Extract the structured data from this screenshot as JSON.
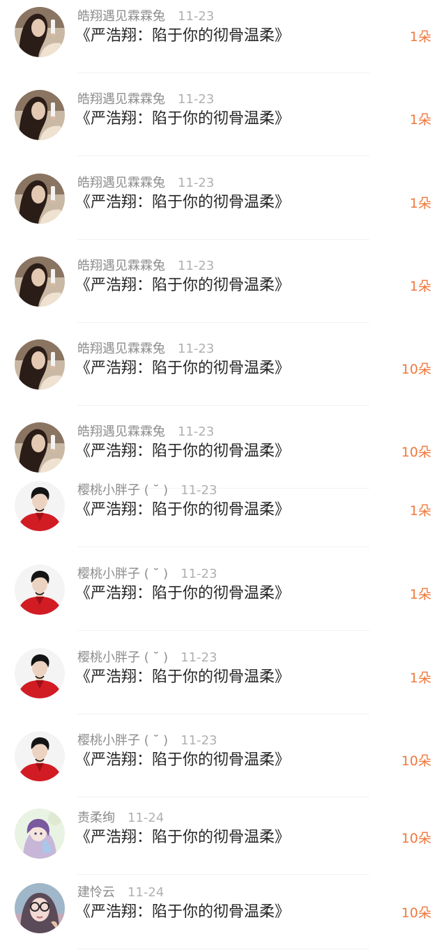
{
  "gifts": [
    {
      "user": "皓翔遇见霖霖兔",
      "date": "11-23",
      "book": "《严浩翔：陷于你的彻骨温柔》",
      "count": "1朵",
      "avatar": "avatar-dark-hair-woman-icon"
    },
    {
      "user": "皓翔遇见霖霖兔",
      "date": "11-23",
      "book": "《严浩翔：陷于你的彻骨温柔》",
      "count": "1朵",
      "avatar": "avatar-dark-hair-woman-icon"
    },
    {
      "user": "皓翔遇见霖霖兔",
      "date": "11-23",
      "book": "《严浩翔：陷于你的彻骨温柔》",
      "count": "1朵",
      "avatar": "avatar-dark-hair-woman-icon"
    },
    {
      "user": "皓翔遇见霖霖兔",
      "date": "11-23",
      "book": "《严浩翔：陷于你的彻骨温柔》",
      "count": "1朵",
      "avatar": "avatar-dark-hair-woman-icon"
    },
    {
      "user": "皓翔遇见霖霖兔",
      "date": "11-23",
      "book": "《严浩翔：陷于你的彻骨温柔》",
      "count": "10朵",
      "avatar": "avatar-dark-hair-woman-icon"
    },
    {
      "user": "皓翔遇见霖霖兔",
      "date": "11-23",
      "book": "《严浩翔：陷于你的彻骨温柔》",
      "count": "10朵",
      "avatar": "avatar-dark-hair-woman-icon"
    },
    {
      "user": "樱桃小胖子 ( ˘̆ )",
      "date": "11-23",
      "book": "《严浩翔：陷于你的彻骨温柔》",
      "count": "1朵",
      "avatar": "avatar-red-shirt-boy-icon"
    },
    {
      "user": "樱桃小胖子 ( ˘̆ )",
      "date": "11-23",
      "book": "《严浩翔：陷于你的彻骨温柔》",
      "count": "1朵",
      "avatar": "avatar-red-shirt-boy-icon"
    },
    {
      "user": "樱桃小胖子 ( ˘̆ )",
      "date": "11-23",
      "book": "《严浩翔：陷于你的彻骨温柔》",
      "count": "1朵",
      "avatar": "avatar-red-shirt-boy-icon"
    },
    {
      "user": "樱桃小胖子 ( ˘̆ )",
      "date": "11-23",
      "book": "《严浩翔：陷于你的彻骨温柔》",
      "count": "10朵",
      "avatar": "avatar-red-shirt-boy-icon"
    },
    {
      "user": "责柔绚",
      "date": "11-24",
      "book": "《严浩翔：陷于你的彻骨温柔》",
      "count": "10朵",
      "avatar": "avatar-anime-girl-icon"
    },
    {
      "user": "建怜云",
      "date": "11-24",
      "book": "《严浩翔：陷于你的彻骨温柔》",
      "count": "10朵",
      "avatar": "avatar-girl-glasses-icon"
    }
  ],
  "colors": {
    "count": "#f0783c",
    "username": "#8d8d8d",
    "date": "#b0b0b0",
    "title": "#262626",
    "separator": "#f1f1f1"
  }
}
